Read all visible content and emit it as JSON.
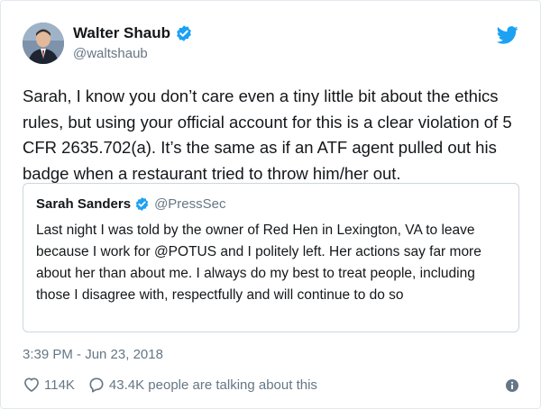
{
  "author": {
    "name": "Walter Shaub",
    "handle": "@waltshaub"
  },
  "tweet": {
    "text": "Sarah, I know you don’t care even a tiny little bit about the ethics rules, but using your official account for this is a clear violation of 5 CFR 2635.702(a). It’s the same as if an ATF agent pulled out his badge when a restaurant tried to throw him/her out."
  },
  "quoted": {
    "name": "Sarah Sanders",
    "handle": "@PressSec",
    "text": "Last night I was told by the owner of Red Hen in Lexington, VA to leave because I work for @POTUS and I politely left. Her actions say far more about her than about me. I always do my best to treat people, including those I disagree with, respectfully and will continue to do so"
  },
  "timestamp": "3:39 PM - Jun 23, 2018",
  "stats": {
    "likes": "114K",
    "talking": "43.4K people are talking about this"
  },
  "colors": {
    "accent": "#1da1f2",
    "secondary_text": "#657786",
    "border": "#e1e8ed"
  },
  "icons": {
    "verified": "verified-badge-icon",
    "brand": "twitter-bird-icon",
    "like": "heart-icon",
    "reply": "speech-bubble-icon",
    "info": "info-icon"
  }
}
